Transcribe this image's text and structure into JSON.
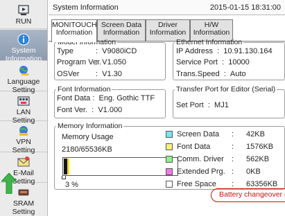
{
  "sidebar": {
    "items": [
      {
        "label1": "RUN",
        "label2": "",
        "icon": "run-icon"
      },
      {
        "label1": "System",
        "label2": "Information",
        "icon": "info-icon"
      },
      {
        "label1": "Language",
        "label2": "Setting",
        "icon": "language-icon"
      },
      {
        "label1": "LAN",
        "label2": "Setting",
        "icon": "lan-icon"
      },
      {
        "label1": "VPN",
        "label2": "Setting",
        "icon": "vpn-icon"
      },
      {
        "label1": "E-Mail",
        "label2": "Setting",
        "icon": "email-icon"
      },
      {
        "label1": "SRAM",
        "label2": "Setting",
        "icon": "sram-icon"
      }
    ]
  },
  "header": {
    "title": "System Information",
    "datetime": "2015-01-15 18:31:00"
  },
  "tabs": [
    {
      "line1": "MONITOUCH",
      "line2": "Information"
    },
    {
      "line1": "Screen Data",
      "line2": "Information"
    },
    {
      "line1": "Driver",
      "line2": "Information"
    },
    {
      "line1": "H/W",
      "line2": "Information"
    }
  ],
  "model": {
    "legend": "Model Information",
    "type_label": "Type",
    "type_value": "V9080iCD",
    "program_label": "Program Ver.",
    "program_value": "V1.050",
    "os_label": "OSVer",
    "os_value": "V1.30"
  },
  "ethernet": {
    "legend": "Ethernet Information",
    "ip_label": "IP Address",
    "ip_value": "10.91.130.164",
    "port_label": "Service Port",
    "port_value": "10000",
    "speed_label": "Trans.Speed",
    "speed_value": "Auto"
  },
  "font": {
    "legend": "Font Information",
    "data_label": "Font Data",
    "data_value": "Eng. Gothic TTF",
    "ver_label": "Font Ver.",
    "ver_value": "V1.000"
  },
  "transfer": {
    "legend": "Transfer Port for Editor (Serial)",
    "set_label": "Set Port",
    "set_value": "MJ1"
  },
  "memory": {
    "legend": "Memory Information",
    "usage_label": "Memory Usage",
    "usage_value": "2180/65536KB",
    "percent_text": "3 %",
    "percent": 3,
    "breakdown": [
      {
        "name": "Screen Data",
        "sep": ":",
        "size": "42KB",
        "color": "#7fe3f0"
      },
      {
        "name": "Font Data",
        "sep": ":",
        "size": "1576KB",
        "color": "#f7f07a"
      },
      {
        "name": "Comm. Driver",
        "sep": ":",
        "size": "562KB",
        "color": "#8ff08f"
      },
      {
        "name": "Extended Prg.",
        "sep": ":",
        "size": "0KB",
        "color": "#f07ae8"
      },
      {
        "name": "Free Space",
        "sep": ":",
        "size": "63356KB",
        "color": "#ffffff"
      }
    ]
  },
  "battery_warning": "Battery changeover require"
}
